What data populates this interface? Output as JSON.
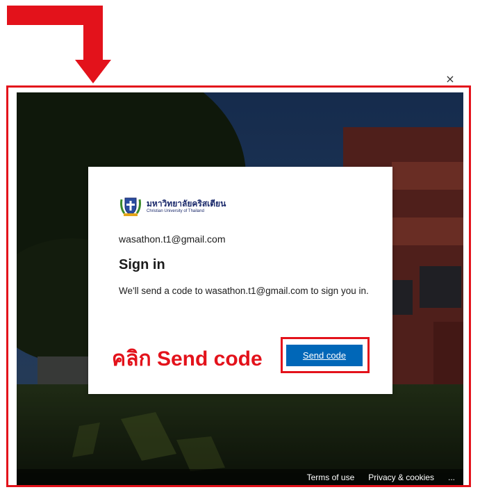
{
  "dialog": {
    "close_glyph": "×",
    "logo": {
      "thai_name": "มหาวิทยาลัยคริสเตียน",
      "english_name": "Christian University of Thailand"
    },
    "account_email": "wasathon.t1@gmail.com",
    "title": "Sign in",
    "description": "We'll send a code to wasathon.t1@gmail.com to sign you in.",
    "send_code_label": "Send code"
  },
  "annotation": {
    "instruction_text": "คลิก Send code",
    "color": "#e3121b"
  },
  "footer": {
    "terms_label": "Terms of use",
    "privacy_label": "Privacy & cookies",
    "more_label": "..."
  },
  "colors": {
    "primary_button": "#0067b8",
    "annotation_red": "#e3121b"
  }
}
